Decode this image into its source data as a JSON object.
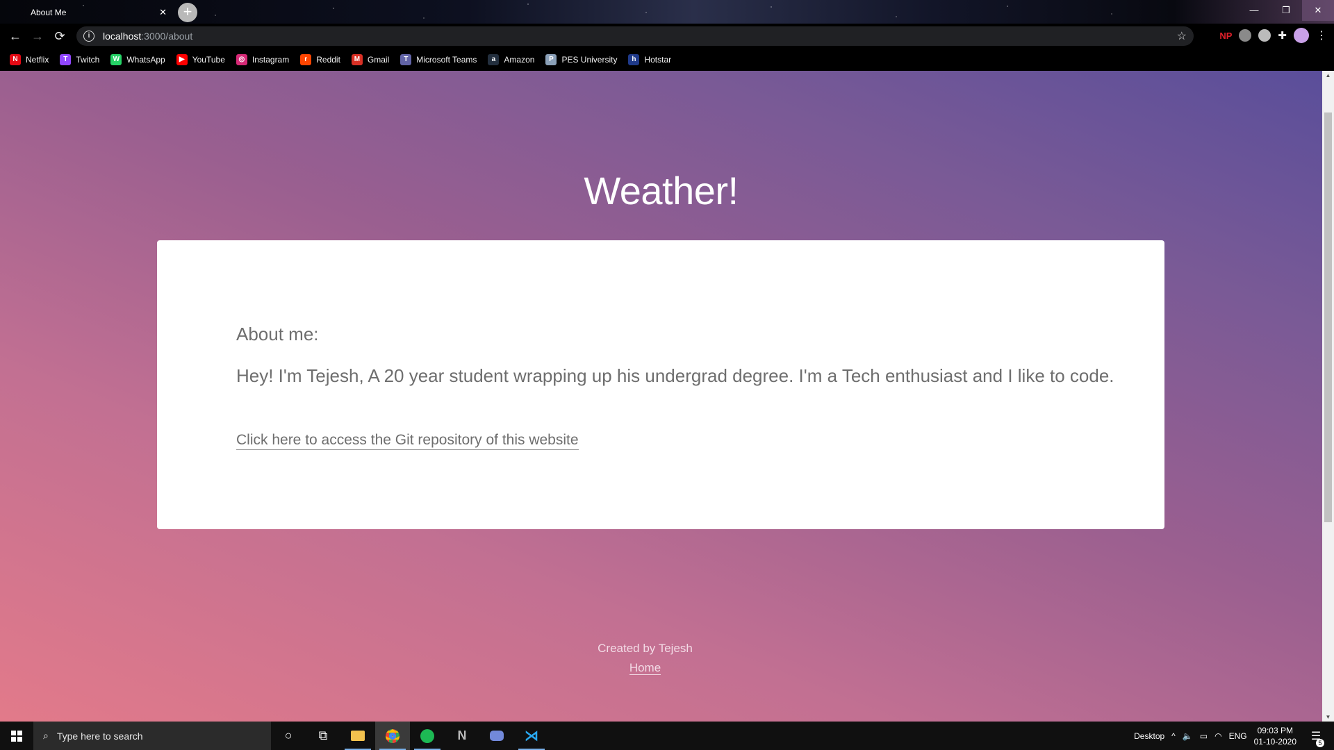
{
  "browser": {
    "tab_title": "About Me",
    "tab_close": "✕",
    "new_tab": "+",
    "window_controls": [
      "—",
      "❐",
      "✕"
    ],
    "url_host": "localhost",
    "url_path": ":3000/about",
    "np_extension": "NP",
    "bookmarks": [
      {
        "label": "Netflix",
        "icon": "N",
        "color": "#e50914"
      },
      {
        "label": "Twitch",
        "icon": "T",
        "color": "#9146ff"
      },
      {
        "label": "WhatsApp",
        "icon": "W",
        "color": "#25d366"
      },
      {
        "label": "YouTube",
        "icon": "▶",
        "color": "#ff0000"
      },
      {
        "label": "Instagram",
        "icon": "◎",
        "color": "#d62976"
      },
      {
        "label": "Reddit",
        "icon": "r",
        "color": "#ff4500"
      },
      {
        "label": "Gmail",
        "icon": "M",
        "color": "#d93025"
      },
      {
        "label": "Microsoft Teams",
        "icon": "T",
        "color": "#6264a7"
      },
      {
        "label": "Amazon",
        "icon": "a",
        "color": "#232f3e"
      },
      {
        "label": "PES University",
        "icon": "P",
        "color": "#8aa0b8"
      },
      {
        "label": "Hotstar",
        "icon": "h",
        "color": "#1f3a8a"
      }
    ]
  },
  "page": {
    "title": "Weather!",
    "card": {
      "heading": "About me:",
      "bio": "Hey! I'm Tejesh, A 20 year student wrapping up his undergrad degree. I'm a Tech enthusiast and I like to code.",
      "repo_link": "Click here to access the Git repository of this website"
    },
    "footer": {
      "credit": "Created by Tejesh",
      "home_link": "Home"
    }
  },
  "taskbar": {
    "search_placeholder": "Type here to search",
    "apps": [
      "cortana-icon",
      "task-view-icon",
      "file-explorer-icon",
      "chrome-icon",
      "spotify-icon",
      "notion-icon",
      "discord-icon",
      "vscode-icon"
    ],
    "desktop_label": "Desktop",
    "language": "ENG",
    "time": "09:03 PM",
    "date": "01-10-2020",
    "notification_count": "5"
  }
}
